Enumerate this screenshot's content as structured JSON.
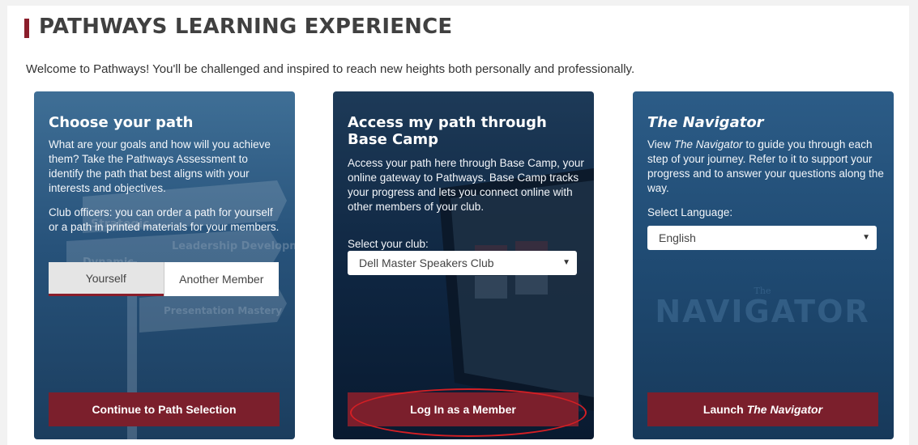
{
  "header": {
    "title": "PATHWAYS LEARNING EXPERIENCE",
    "welcome": "Welcome to Pathways! You'll be challenged and inspired to reach new heights both personally and professionally."
  },
  "cards": {
    "path": {
      "title": "Choose your path",
      "para1": "What are your goals and how will you achieve them? Take the Pathways Assessment to identify the path that best aligns with your interests and objectives.",
      "para2": "Club officers: you can order a path for yourself or a path in printed materials for your members.",
      "toggle_yourself": "Yourself",
      "toggle_another": "Another Member",
      "button": "Continue to Path Selection"
    },
    "basecamp": {
      "title": "Access my path through Base Camp",
      "para": "Access your path here through Base Camp, your online gateway to Pathways. Base Camp tracks your progress and lets you connect online with other members of your club.",
      "select_label": "Select your club:",
      "club_value": "Dell Master Speakers Club",
      "button": "Log In as a Member"
    },
    "navigator": {
      "title": "The Navigator",
      "para_prefix": "View ",
      "para_italic": "The Navigator",
      "para_suffix": " to guide you through each step of your journey. Refer to it to support your progress and to answer your questions along the way.",
      "select_label": "Select Language:",
      "language_value": "English",
      "button_prefix": "Launch",
      "button_italic": "The Navigator",
      "watermark": "NAVIGATOR",
      "watermark_small": "The"
    }
  },
  "signpost": {
    "sign1": "Strategic",
    "sign2": "Leadership Development",
    "sign3": "Dynamic",
    "sign4": "Presentation Mastery"
  },
  "icons": {
    "caret": "▼"
  },
  "colors": {
    "accent": "#8b1e2b",
    "button": "#7b1f2c",
    "highlight": "#d41f24"
  }
}
